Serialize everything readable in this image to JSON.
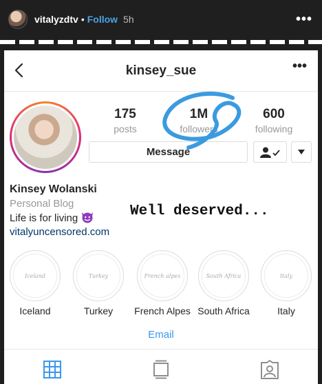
{
  "story": {
    "username": "vitalyzdtv",
    "separator": "•",
    "follow_label": "Follow",
    "time": "5h",
    "more_label": "•••"
  },
  "profile": {
    "username": "kinsey_sue",
    "more_label": "•••",
    "stats": [
      {
        "value": "175",
        "label": "posts"
      },
      {
        "value": "1M",
        "label": "followers"
      },
      {
        "value": "600",
        "label": "following"
      }
    ],
    "message_label": "Message",
    "full_name": "Kinsey Wolanski",
    "category": "Personal Blog",
    "bio": "Life is for living",
    "website": "vitalyuncensored.com",
    "email_label": "Email"
  },
  "overlay_caption": "Well deserved...",
  "highlights": [
    {
      "label": "Iceland",
      "cover_text": "Iceland"
    },
    {
      "label": "Turkey",
      "cover_text": "Turkey"
    },
    {
      "label": "French Alpes",
      "cover_text": "French alpes"
    },
    {
      "label": "South Africa",
      "cover_text": "South Africa"
    },
    {
      "label": "Italy",
      "cover_text": "Italy"
    }
  ],
  "colors": {
    "accent_blue": "#3897f0",
    "annotation_circle": "#3a9be0",
    "story_background": "#1f1f1f"
  },
  "icons": [
    "back-chevron-icon",
    "more-dots-icon",
    "person-check-icon",
    "chevron-down-icon",
    "devil-emoji-icon",
    "grid-icon",
    "feed-icon",
    "tagged-icon"
  ]
}
